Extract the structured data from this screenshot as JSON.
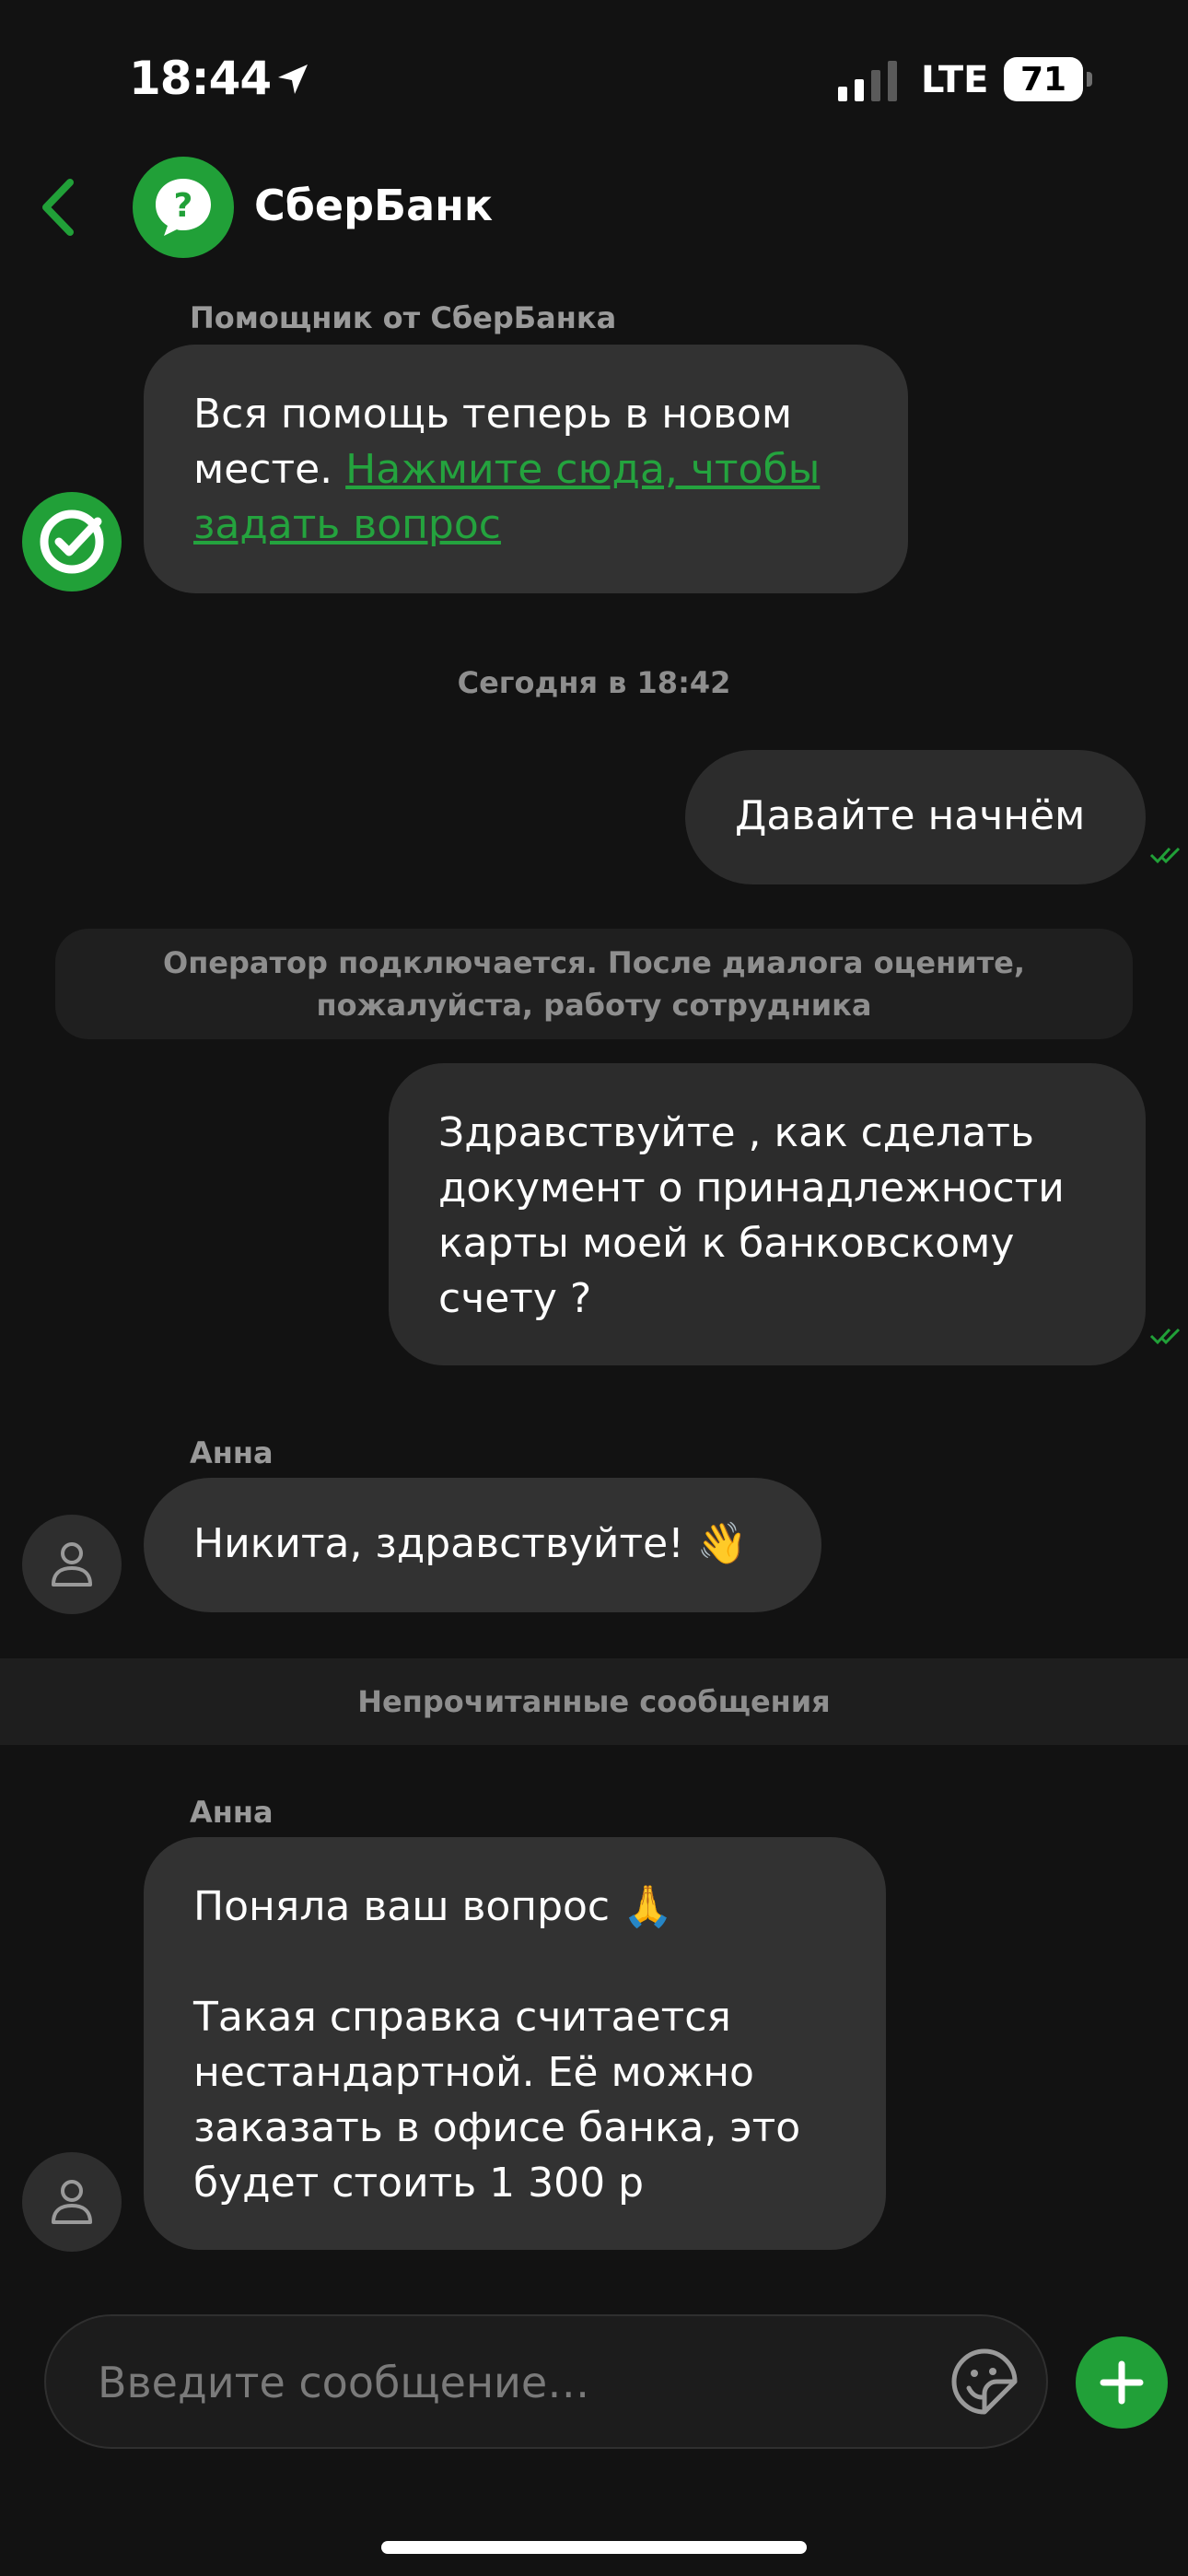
{
  "status_bar": {
    "time": "18:44",
    "network": "LTE",
    "battery": "71"
  },
  "header": {
    "title": "СберБанк"
  },
  "messages": {
    "bot": {
      "sender": "Помощник от СберБанка",
      "text": "Вся помощь теперь в новом месте. ",
      "link": "Нажмите сюда, чтобы задать вопрос"
    },
    "date_divider": "Сегодня в 18:42",
    "out1": "Давайте начнём",
    "system_notice": "Оператор подключается. После диалога оцените, пожалуйста, работу сотрудника",
    "out2": "Здравствуйте , как сделать документ о принадлежности карты моей к банковскому счету ?",
    "op1": {
      "sender": "Анна",
      "text": "Никита, здравствуйте! 👋"
    },
    "unread_divider": "Непрочитанные сообщения",
    "op2": {
      "sender": "Анна",
      "line1": "Поняла ваш вопрос 🙏",
      "line2": "Такая справка считается нестандартной. Её можно заказать в офисе банка, это будет стоить 1 300 р"
    }
  },
  "composer": {
    "placeholder": "Введите сообщение…"
  },
  "colors": {
    "accent": "#21a038",
    "bubble": "#323232",
    "background": "#121212"
  }
}
